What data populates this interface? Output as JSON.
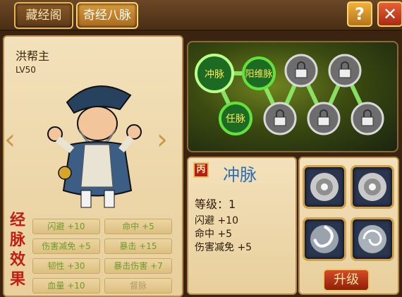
{
  "tabs": [
    {
      "label": "藏经阁"
    },
    {
      "label": "奇经八脉"
    }
  ],
  "buttons": {
    "help": "?",
    "close": "✕",
    "upgrade": "升级"
  },
  "character": {
    "name": "洪帮主",
    "level": "LV50"
  },
  "effects": {
    "title_chars": [
      "经",
      "脉",
      "效",
      "果"
    ],
    "stats": [
      {
        "label": "闪避 +10"
      },
      {
        "label": "命中 +5"
      },
      {
        "label": "伤害减免 +5"
      },
      {
        "label": "暴击 +15"
      },
      {
        "label": "韧性 +30"
      },
      {
        "label": "暴击伤害 +7"
      },
      {
        "label": "血量 +10"
      },
      {
        "label": "督脉"
      }
    ]
  },
  "meridian_nodes": [
    {
      "label": "冲脉",
      "state": "selected"
    },
    {
      "label": "阳维脉",
      "state": "unlocked"
    },
    {
      "label": "任脉",
      "state": "unlocked"
    },
    {
      "label": "",
      "state": "locked"
    },
    {
      "label": "",
      "state": "locked"
    },
    {
      "label": "",
      "state": "locked"
    },
    {
      "label": "",
      "state": "locked"
    },
    {
      "label": "",
      "state": "locked"
    }
  ],
  "selected_node": {
    "grade_badge": "丙",
    "name": "冲脉",
    "level_text": "等级：1",
    "stats": [
      "闪避 +10",
      "命中 +5",
      "伤害减免 +5"
    ]
  },
  "skill_slots": [
    {
      "icon": "swirl-icon"
    },
    {
      "icon": "swirl-icon"
    },
    {
      "icon": "vortex-icon"
    },
    {
      "icon": "spiral-icon"
    }
  ],
  "colors": {
    "accent": "#e8b84a",
    "node_active": "#3cc23a",
    "badge": "#b51c12"
  }
}
